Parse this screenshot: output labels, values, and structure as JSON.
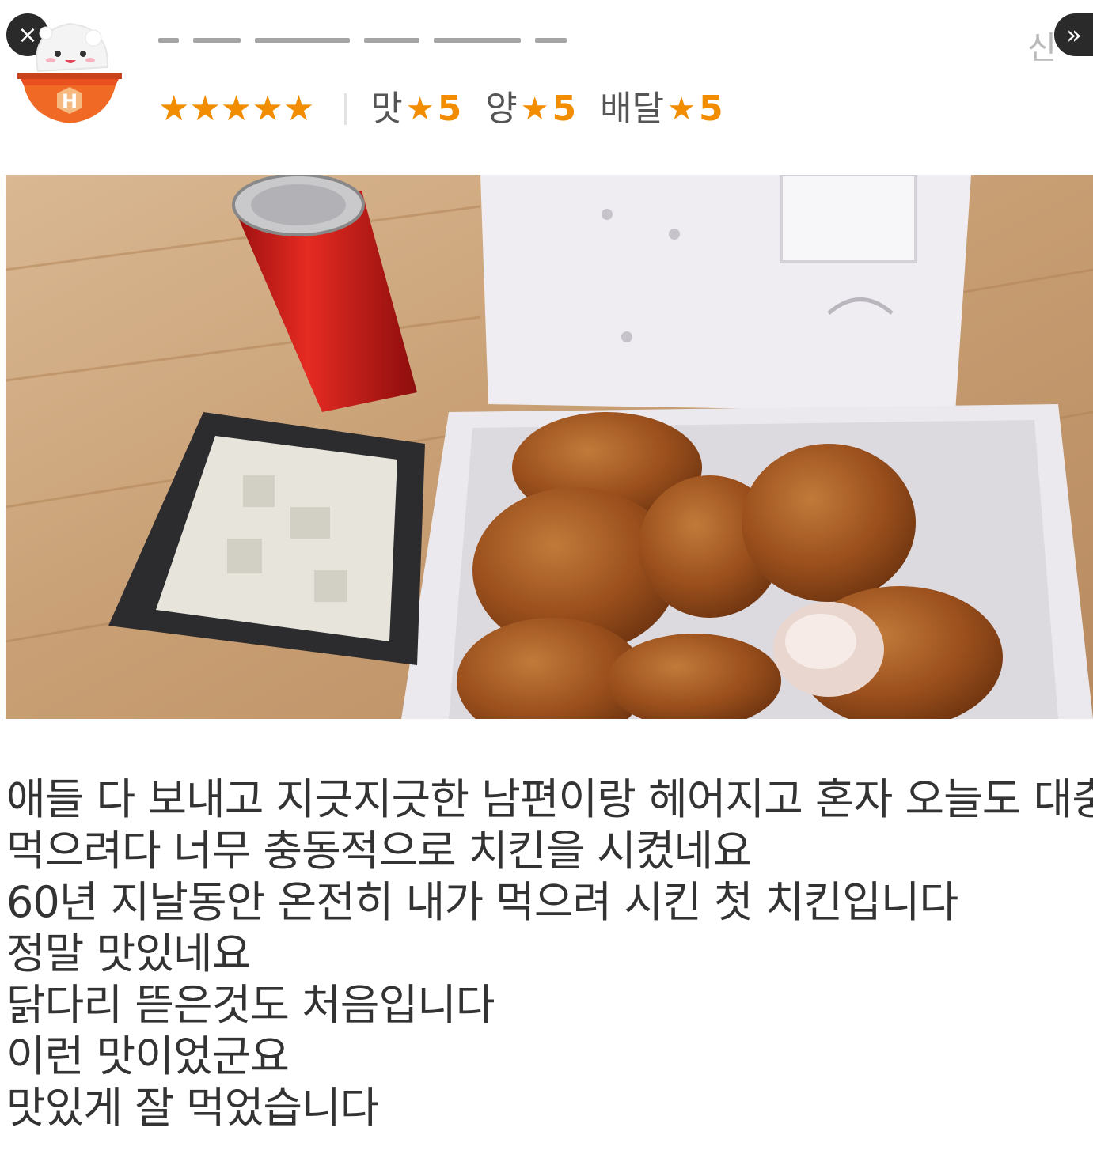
{
  "header": {
    "close_icon": "×",
    "next_icon": "»",
    "report_label": "신",
    "overall_stars": "★★★★★",
    "ratings": [
      {
        "label": "맛",
        "star": "★",
        "score": "5"
      },
      {
        "label": "양",
        "star": "★",
        "score": "5"
      },
      {
        "label": "배달",
        "star": "★",
        "score": "5"
      }
    ]
  },
  "colors": {
    "accent": "#f28c00",
    "button_bg": "#2a2a2a",
    "text": "#333333"
  },
  "review": {
    "lines": [
      "애들 다 보내고 지긋지긋한 남편이랑 헤어지고 혼자 오늘도 대충",
      "먹으려다 너무 충동적으로 치킨을 시켰네요",
      "60년 지날동안 온전히 내가 먹으려 시킨 첫 치킨입니다",
      "정말 맛있네요",
      "닭다리 뜯은것도 처음입니다",
      "이런 맛이었군요",
      "맛있게 잘 먹었습니다"
    ]
  }
}
